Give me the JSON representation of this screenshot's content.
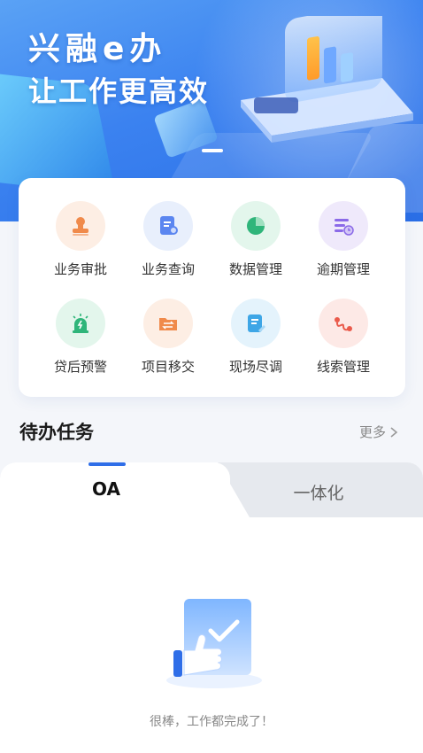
{
  "banner": {
    "line1": "兴融e办",
    "line2": "让工作更高效"
  },
  "grid": [
    {
      "label": "业务审批",
      "icon": "stamp-icon",
      "bg": "#fdeee4",
      "fg": "#f08a4b"
    },
    {
      "label": "业务查询",
      "icon": "document-search-icon",
      "bg": "#e8effc",
      "fg": "#5b86f0"
    },
    {
      "label": "数据管理",
      "icon": "pie-chart-icon",
      "bg": "#e3f6ec",
      "fg": "#2fb57a"
    },
    {
      "label": "逾期管理",
      "icon": "list-clock-icon",
      "bg": "#efe9fb",
      "fg": "#8b6ae8"
    },
    {
      "label": "贷后预警",
      "icon": "alarm-light-icon",
      "bg": "#e3f6ec",
      "fg": "#2fb57a"
    },
    {
      "label": "项目移交",
      "icon": "folder-transfer-icon",
      "bg": "#fdeee4",
      "fg": "#f08a4b"
    },
    {
      "label": "现场尽调",
      "icon": "clipboard-pen-icon",
      "bg": "#e4f3fc",
      "fg": "#3ea6e6"
    },
    {
      "label": "线索管理",
      "icon": "route-icon",
      "bg": "#fde9e6",
      "fg": "#ea5a4b"
    }
  ],
  "pending": {
    "title": "待办任务",
    "more": "更多"
  },
  "tabs": {
    "active": "OA",
    "inactive": "一体化"
  },
  "empty": {
    "message": "很棒，工作都完成了！"
  },
  "colors": {
    "accent": "#2f6ee8"
  }
}
